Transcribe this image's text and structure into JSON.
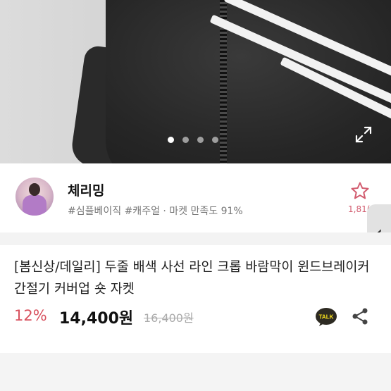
{
  "colors": {
    "accent": "#d8525f",
    "star": "#d25c6f",
    "background": "#ffffff"
  },
  "photo": {
    "icons": {
      "fullscreen": "expand-arrows-icon"
    },
    "carousel": {
      "count": 4,
      "active_index": 0
    }
  },
  "seller": {
    "name": "체리밍",
    "tags": "#심플베이직 #캐주얼 · 마켓 만족도 91%",
    "favorite_count": "1,81(",
    "icons": {
      "favorite": "star-outline-icon",
      "panel": "chevron-left-icon"
    }
  },
  "product": {
    "title": "[봄신상/데일리] 두줄 배색 사선 라인 크롭 바람막이 윈드브레이커 간절기 커버업 숏 자켓",
    "discount": "12%",
    "price": "14,400원",
    "original_price": "16,400원",
    "talk_label": "TALK",
    "icons": {
      "talk": "kakao-talk-icon",
      "share": "share-icon"
    }
  },
  "side_handle": {
    "glyph": "‹"
  }
}
